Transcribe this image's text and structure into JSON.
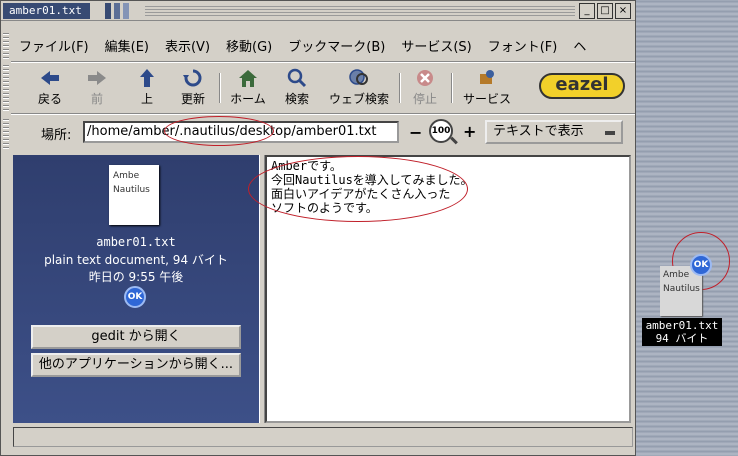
{
  "window": {
    "title": "amber01.txt",
    "controls": {
      "minimize": "_",
      "maximize": "□",
      "close": "×"
    }
  },
  "menubar": {
    "items": [
      "ファイル(F)",
      "編集(E)",
      "表示(V)",
      "移動(G)",
      "ブックマーク(B)",
      "サービス(S)",
      "フォント(F)",
      "ヘ"
    ]
  },
  "toolbar": {
    "back": "戻る",
    "forward": "前",
    "up": "上",
    "reload": "更新",
    "home": "ホーム",
    "search": "検索",
    "web_search": "ウェブ検索",
    "stop": "停止",
    "services": "サービス",
    "logo": "eazel"
  },
  "location": {
    "label": "場所:",
    "path": "/home/amber/.nautilus/desktop/amber01.txt",
    "zoom_level": "100",
    "zoom_out": "−",
    "zoom_in": "+",
    "view_as": "テキストで表示"
  },
  "sidebar": {
    "thumbnail_lines": [
      "Ambe",
      "Nautilus"
    ],
    "filename": "amber01.txt",
    "description": "plain text document, 94 バイト",
    "modified": "昨日の 9:55 午後",
    "emblem": "OK",
    "open_with_gedit": "gedit から開く",
    "open_with_other": "他のアプリケーションから開く..."
  },
  "content": {
    "lines": [
      "Amberです。",
      "今回Nautilusを導入してみました。",
      "面白いアイデアがたくさん入った",
      "ソフトのようです。"
    ]
  },
  "desktop_icon": {
    "thumbnail_lines": [
      "Ambe",
      "Nautilus"
    ],
    "emblem": "OK",
    "name": "amber01.txt",
    "size": "94 バイト"
  },
  "colors": {
    "sidebar_bg": "#2f3e6e",
    "annotation": "#c0202a",
    "emblem": "#2f67d6",
    "title_tab": "#374a73"
  }
}
